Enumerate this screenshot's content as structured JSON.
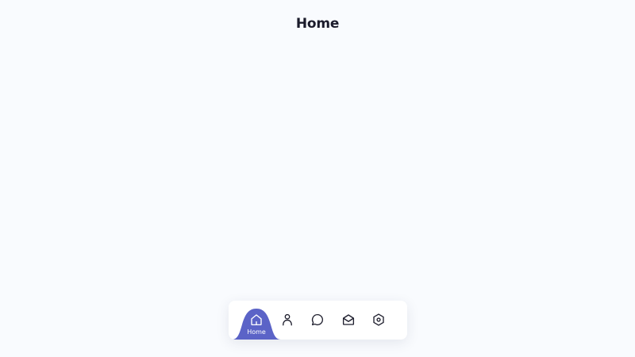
{
  "header": {
    "title": "Home"
  },
  "tabbar": {
    "active_index": 0,
    "active_color": "#5b63c7",
    "icon_color": "#1f1f2e",
    "tabs": [
      {
        "label": "Home",
        "icon": "home-icon"
      },
      {
        "label": "",
        "icon": "user-icon"
      },
      {
        "label": "",
        "icon": "chat-icon"
      },
      {
        "label": "",
        "icon": "mail-icon"
      },
      {
        "label": "",
        "icon": "settings-icon"
      }
    ]
  }
}
